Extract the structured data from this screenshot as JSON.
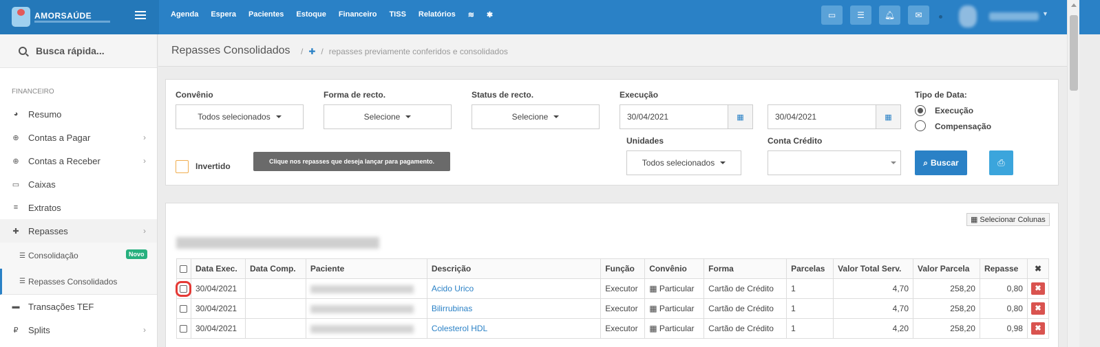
{
  "brand": {
    "name": "AMORSAÚDE"
  },
  "nav": {
    "items": [
      "Agenda",
      "Espera",
      "Pacientes",
      "Estoque",
      "Financeiro",
      "TISS",
      "Relatórios"
    ]
  },
  "sidebar": {
    "search": "Busca rápida...",
    "section": "FINANCEIRO",
    "items": [
      {
        "label": "Resumo",
        "icon": "pie-chart-icon"
      },
      {
        "label": "Contas a Pagar",
        "icon": "arrow-up-circle-icon"
      },
      {
        "label": "Contas a Receber",
        "icon": "arrow-down-circle-icon"
      },
      {
        "label": "Caixas",
        "icon": "inbox-icon"
      },
      {
        "label": "Extratos",
        "icon": "list-icon"
      },
      {
        "label": "Repasses",
        "icon": "puzzle-icon"
      },
      {
        "label": "Transações TEF",
        "icon": "card-icon"
      },
      {
        "label": "Splits",
        "icon": "currency-icon"
      }
    ],
    "sub": [
      {
        "label": "Consolidação",
        "badge": "Novo"
      },
      {
        "label": "Repasses Consolidados"
      }
    ]
  },
  "header": {
    "title": "Repasses Consolidados",
    "breadcrumb": "repasses previamente conferidos e consolidados"
  },
  "filters": {
    "convenio": {
      "label": "Convênio",
      "value": "Todos selecionados"
    },
    "forma": {
      "label": "Forma de recto.",
      "value": "Selecione"
    },
    "status": {
      "label": "Status de recto.",
      "value": "Selecione"
    },
    "execucao": {
      "label": "Execução",
      "from": "30/04/2021",
      "to": "30/04/2021"
    },
    "tipo": {
      "label": "Tipo de Data:",
      "options": [
        "Execução",
        "Compensação"
      ],
      "selected": "Execução"
    },
    "unidades": {
      "label": "Unidades",
      "value": "Todos selecionados"
    },
    "conta": {
      "label": "Conta Crédito",
      "value": ""
    },
    "invertido": "Invertido",
    "tooltip": "Clique nos repasses que deseja lançar para pagamento.",
    "buscar": "Buscar"
  },
  "table": {
    "select_columns": "Selecionar Colunas",
    "headers": [
      "Data Exec.",
      "Data Comp.",
      "Paciente",
      "Descrição",
      "Função",
      "Convênio",
      "Forma",
      "Parcelas",
      "Valor Total Serv.",
      "Valor Parcela",
      "Repasse",
      "✖"
    ],
    "rows": [
      {
        "exec": "30/04/2021",
        "comp": "",
        "desc": "Acido Urico",
        "funcao": "Executor",
        "convenio": "Particular",
        "forma": "Cartão de Crédito",
        "parcelas": "1",
        "total": "4,70",
        "parcela": "258,20",
        "repasse": "0,80"
      },
      {
        "exec": "30/04/2021",
        "comp": "",
        "desc": "Bilirrubinas",
        "funcao": "Executor",
        "convenio": "Particular",
        "forma": "Cartão de Crédito",
        "parcelas": "1",
        "total": "4,70",
        "parcela": "258,20",
        "repasse": "0,80"
      },
      {
        "exec": "30/04/2021",
        "comp": "",
        "desc": "Colesterol HDL",
        "funcao": "Executor",
        "convenio": "Particular",
        "forma": "Cartão de Crédito",
        "parcelas": "1",
        "total": "4,20",
        "parcela": "258,20",
        "repasse": "0,98"
      }
    ]
  },
  "colors": {
    "primary": "#2a81c6",
    "danger": "#d9534f",
    "success": "#27b07e"
  }
}
